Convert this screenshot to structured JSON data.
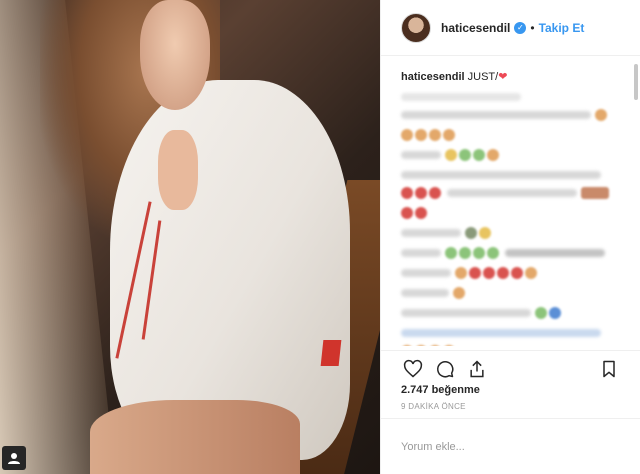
{
  "post": {
    "username": "haticesendil",
    "follow_label": "Takip Et",
    "separator": "•",
    "caption_user": "haticesendil",
    "caption_text": "JUST/",
    "caption_emoji": "❤",
    "likes_text": "2.747 beğenme",
    "time_text": "9 DAKİKA ÖNCE",
    "comment_placeholder": "Yorum ekle..."
  },
  "icons": {
    "verified": "verified-badge-icon",
    "like": "heart-icon",
    "comment": "comment-bubble-icon",
    "share": "share-icon",
    "save": "bookmark-icon",
    "tag": "user-tag-icon"
  },
  "colors": {
    "accent": "#3897f0",
    "heart": "#ed4956",
    "text": "#262626",
    "muted": "#999999",
    "border": "#efefef"
  }
}
